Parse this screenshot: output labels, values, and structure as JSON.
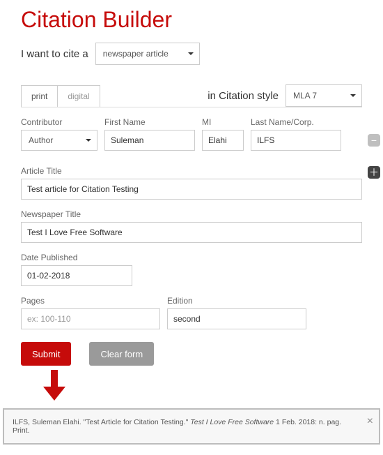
{
  "title": "Citation Builder",
  "lead": "I want to cite a",
  "source_type": {
    "selected": "newspaper article"
  },
  "style": {
    "label": "in Citation style",
    "selected": "MLA 7"
  },
  "tabs": {
    "print": "print",
    "digital": "digital",
    "active": "print"
  },
  "contributor": {
    "label": "Contributor",
    "role": "Author",
    "first_label": "First Name",
    "first": "Suleman",
    "mi_label": "MI",
    "mi": "Elahi",
    "last_label": "Last Name/Corp.",
    "last": "ILFS"
  },
  "article": {
    "label": "Article Title",
    "value": "Test article for Citation Testing"
  },
  "newspaper": {
    "label": "Newspaper Title",
    "value": "Test I Love Free Software"
  },
  "date": {
    "label": "Date Published",
    "value": "01-02-2018"
  },
  "pages": {
    "label": "Pages",
    "value": "",
    "placeholder": "ex: 100-110"
  },
  "edition": {
    "label": "Edition",
    "value": "second"
  },
  "buttons": {
    "submit": "Submit",
    "clear": "Clear form"
  },
  "output": {
    "pre": "ILFS, Suleman Elahi. \"Test Article for Citation Testing.\" ",
    "ital": "Test I Love Free Software",
    "post": " 1 Feb. 2018: n. pag. Print."
  }
}
